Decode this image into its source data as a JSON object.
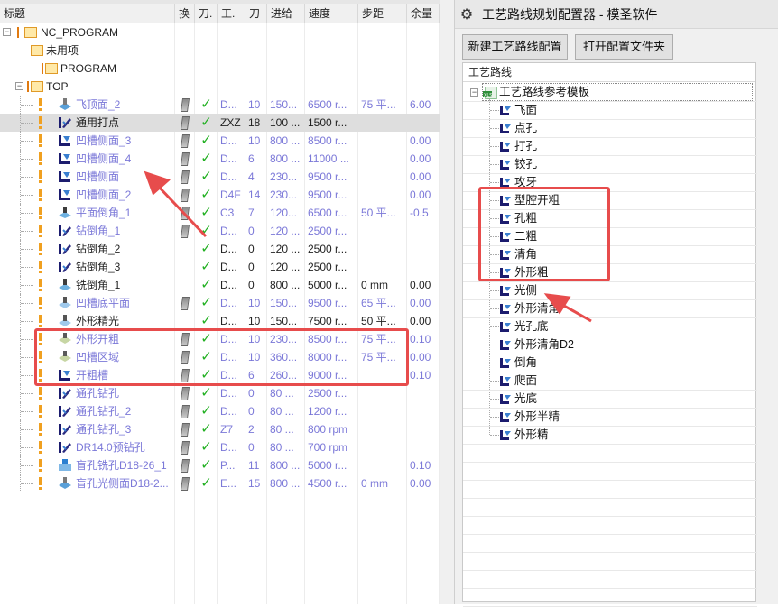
{
  "left": {
    "headers": [
      "标题",
      "换",
      "刀.",
      "工.",
      "刀",
      "进给",
      "速度",
      "步距",
      "余量"
    ],
    "rows": [
      {
        "name": "NC_PROGRAM",
        "kind": "root",
        "level": 0,
        "style": "blk",
        "swap": "",
        "check": "",
        "tool": "",
        "tn": "",
        "feed": "",
        "speed": "",
        "step": "",
        "stock": ""
      },
      {
        "name": "未用项",
        "kind": "folder",
        "level": 1,
        "style": "blk",
        "swap": "",
        "check": "",
        "tool": "",
        "tn": "",
        "feed": "",
        "speed": "",
        "step": "",
        "stock": ""
      },
      {
        "name": "PROGRAM",
        "kind": "folder",
        "level": 2,
        "style": "blk",
        "swap": "",
        "check": "",
        "tool": "",
        "tn": "",
        "feed": "",
        "speed": "",
        "step": "",
        "stock": ""
      },
      {
        "name": "TOP",
        "kind": "folder-open",
        "level": 1,
        "style": "blk",
        "swap": "",
        "check": "",
        "tool": "",
        "tn": "",
        "feed": "",
        "speed": "",
        "step": "",
        "stock": ""
      },
      {
        "name": "飞顶面_2",
        "kind": "op",
        "icon": "face-mill",
        "style": "dim",
        "excl": true,
        "swap": "y",
        "check": "y",
        "tool": "D...",
        "tn": "10",
        "feed": "150...",
        "speed": "6500 r...",
        "step": "75 平...",
        "stock": "6.00"
      },
      {
        "name": "通用打点",
        "kind": "op",
        "icon": "drill",
        "style": "blk",
        "excl": true,
        "selected": true,
        "swap": "y",
        "check": "y",
        "tool": "ZXZ",
        "tn": "18",
        "feed": "100 ...",
        "speed": "1500 r...",
        "step": "",
        "stock": ""
      },
      {
        "name": "凹槽侧面_3",
        "kind": "op",
        "icon": "wall",
        "style": "dim",
        "excl": true,
        "swap": "y",
        "check": "y",
        "tool": "D...",
        "tn": "10",
        "feed": "800 ...",
        "speed": "8500 r...",
        "step": "",
        "stock": "0.00"
      },
      {
        "name": "凹槽侧面_4",
        "kind": "op",
        "icon": "wall",
        "style": "dim",
        "excl": true,
        "swap": "y",
        "check": "y",
        "tool": "D...",
        "tn": "6",
        "feed": "800 ...",
        "speed": "11000 ...",
        "step": "",
        "stock": "0.00"
      },
      {
        "name": "凹槽侧面",
        "kind": "op",
        "icon": "wall",
        "style": "dim",
        "excl": true,
        "swap": "y",
        "check": "y",
        "tool": "D...",
        "tn": "4",
        "feed": "230...",
        "speed": "9500 r...",
        "step": "",
        "stock": "0.00"
      },
      {
        "name": "凹槽侧面_2",
        "kind": "op",
        "icon": "wall",
        "style": "dim",
        "excl": true,
        "swap": "y",
        "check": "y",
        "tool": "D4F",
        "tn": "14",
        "feed": "230...",
        "speed": "9500 r...",
        "step": "",
        "stock": "0.00"
      },
      {
        "name": "平面倒角_1",
        "kind": "op",
        "icon": "chamfer",
        "style": "dim",
        "excl": true,
        "swap": "y",
        "check": "y",
        "tool": "C3",
        "tn": "7",
        "feed": "120...",
        "speed": "6500 r...",
        "step": "50 平...",
        "stock": "-0.5"
      },
      {
        "name": "钻倒角_1",
        "kind": "op",
        "icon": "drill",
        "style": "dim",
        "excl": true,
        "swap": "y",
        "check": "y",
        "tool": "D...",
        "tn": "0",
        "feed": "120 ...",
        "speed": "2500 r...",
        "step": "",
        "stock": ""
      },
      {
        "name": "钻倒角_2",
        "kind": "op",
        "icon": "drill",
        "style": "blk",
        "excl": true,
        "swap": "",
        "check": "y",
        "tool": "D...",
        "tn": "0",
        "feed": "120 ...",
        "speed": "2500 r...",
        "step": "",
        "stock": ""
      },
      {
        "name": "钻倒角_3",
        "kind": "op",
        "icon": "drill",
        "style": "blk",
        "excl": true,
        "swap": "",
        "check": "y",
        "tool": "D...",
        "tn": "0",
        "feed": "120 ...",
        "speed": "2500 r...",
        "step": "",
        "stock": ""
      },
      {
        "name": "铣倒角_1",
        "kind": "op",
        "icon": "chamfer",
        "style": "blk",
        "excl": true,
        "swap": "",
        "check": "y",
        "tool": "D...",
        "tn": "0",
        "feed": "800 ...",
        "speed": "5000 r...",
        "step": "0 mm",
        "stock": "0.00"
      },
      {
        "name": "凹槽底平面",
        "kind": "op",
        "icon": "floor",
        "style": "dim",
        "excl": true,
        "swap": "y",
        "check": "y",
        "tool": "D...",
        "tn": "10",
        "feed": "150...",
        "speed": "9500 r...",
        "step": "65 平...",
        "stock": "0.00"
      },
      {
        "name": "外形精光",
        "kind": "op",
        "icon": "floor",
        "style": "blk",
        "excl": true,
        "swap": "",
        "check": "y",
        "tool": "D...",
        "tn": "10",
        "feed": "150...",
        "speed": "7500 r...",
        "step": "50 平...",
        "stock": "0.00"
      },
      {
        "name": "外形开粗",
        "kind": "op",
        "icon": "cavity",
        "style": "dim",
        "excl": true,
        "swap": "y",
        "check": "y",
        "tool": "D...",
        "tn": "10",
        "feed": "230...",
        "speed": "8500 r...",
        "step": "75 平...",
        "stock": "0.10"
      },
      {
        "name": "凹槽区域",
        "kind": "op",
        "icon": "cavity",
        "style": "dim",
        "excl": true,
        "swap": "y",
        "check": "y",
        "tool": "D...",
        "tn": "10",
        "feed": "360...",
        "speed": "8000 r...",
        "step": "75 平...",
        "stock": "0.00"
      },
      {
        "name": "开粗槽",
        "kind": "op",
        "icon": "wall",
        "style": "dim",
        "excl": true,
        "swap": "y",
        "check": "y",
        "tool": "D...",
        "tn": "6",
        "feed": "260...",
        "speed": "9000 r...",
        "step": "",
        "stock": "0.10"
      },
      {
        "name": "通孔钻孔",
        "kind": "op",
        "icon": "drill",
        "style": "dim",
        "excl": true,
        "swap": "y",
        "check": "y",
        "tool": "D...",
        "tn": "0",
        "feed": "80 ...",
        "speed": "2500 r...",
        "step": "",
        "stock": ""
      },
      {
        "name": "通孔钻孔_2",
        "kind": "op",
        "icon": "drill",
        "style": "dim",
        "excl": true,
        "swap": "y",
        "check": "y",
        "tool": "D...",
        "tn": "0",
        "feed": "80 ...",
        "speed": "1200 r...",
        "step": "",
        "stock": ""
      },
      {
        "name": "通孔钻孔_3",
        "kind": "op",
        "icon": "drill",
        "style": "dim",
        "excl": true,
        "swap": "y",
        "check": "y",
        "tool": "Z7",
        "tn": "2",
        "feed": "80 ...",
        "speed": "800 rpm",
        "step": "",
        "stock": ""
      },
      {
        "name": "DR14.0预钻孔",
        "kind": "op",
        "icon": "drill",
        "style": "dim",
        "excl": true,
        "swap": "y",
        "check": "y",
        "tool": "D...",
        "tn": "0",
        "feed": "80 ...",
        "speed": "700 rpm",
        "step": "",
        "stock": ""
      },
      {
        "name": "盲孔铣孔D18-26_1",
        "kind": "op",
        "icon": "hole-mill",
        "style": "dim",
        "excl": true,
        "swap": "y",
        "check": "y",
        "tool": "P...",
        "tn": "11",
        "feed": "800 ...",
        "speed": "5000 r...",
        "step": "",
        "stock": "0.10"
      },
      {
        "name": "盲孔光侧面D18-2...",
        "kind": "op",
        "icon": "face-mill",
        "style": "dim",
        "excl": true,
        "swap": "y",
        "check": "y",
        "tool": "E...",
        "tn": "15",
        "feed": "800 ...",
        "speed": "4500 r...",
        "step": "0 mm",
        "stock": "0.00"
      }
    ]
  },
  "right": {
    "title": "工艺路线规划配置器 - 模圣软件",
    "buttons": {
      "new": "新建工艺路线配置",
      "open": "打开配置文件夹"
    },
    "tree_header": "工艺路线",
    "root": "工艺路线参考模板",
    "items": [
      "飞面",
      "点孔",
      "打孔",
      "铰孔",
      "攻牙",
      "型腔开粗",
      "孔粗",
      "二粗",
      "清角",
      "外形粗",
      "光侧",
      "外形清角",
      "光孔底",
      "外形清角D2",
      "倒角",
      "爬面",
      "光底",
      "外形半精",
      "外形精"
    ]
  },
  "colors": {
    "accent_red": "#e74c4c",
    "dim_text": "#7b78d8",
    "check_green": "#22b022",
    "folder": "#ffe9a8"
  }
}
